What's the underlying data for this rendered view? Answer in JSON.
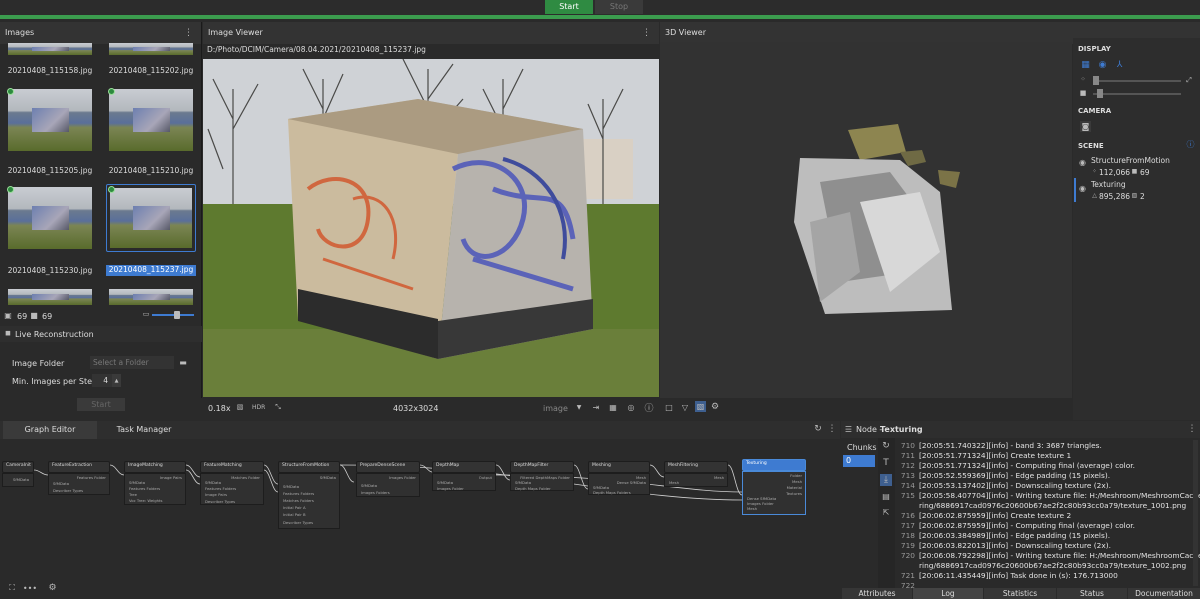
{
  "toolbar": {
    "start_label": "Start",
    "stop_label": "Stop"
  },
  "images_panel": {
    "title": "Images",
    "thumbnails": [
      {
        "label": "20210408_115158.jpg"
      },
      {
        "label": "20210408_115202.jpg"
      },
      {
        "label": "20210408_115205.jpg"
      },
      {
        "label": "20210408_115210.jpg"
      },
      {
        "label": "20210408_115230.jpg"
      },
      {
        "label": "20210408_115237.jpg"
      }
    ],
    "image_count": "69",
    "camera_count": "69",
    "live_reconstruction": {
      "title": "Live Reconstruction",
      "image_folder_label": "Image Folder",
      "image_folder_placeholder": "Select a Folder",
      "min_images_label": "Min. Images per Step",
      "min_images_value": "4",
      "start_label": "Start"
    }
  },
  "image_viewer": {
    "title": "Image Viewer",
    "path": "D:/Photo/DCIM/Camera/08.04.2021/20210408_115237.jpg",
    "zoom": "0.18x",
    "hdr_label": "HDR",
    "resolution": "4032x3024",
    "mode_value": "image"
  },
  "viewer3d": {
    "title": "3D Viewer"
  },
  "display_panel": {
    "display_label": "DISPLAY",
    "camera_label": "CAMERA",
    "scene_label": "SCENE",
    "scene_items": [
      {
        "name": "StructureFromMotion",
        "stat1": "112,066",
        "stat2": "69"
      },
      {
        "name": "Texturing",
        "stat1": "895,286",
        "stat2": "2"
      }
    ]
  },
  "graph": {
    "tabs": [
      "Graph Editor",
      "Task Manager"
    ],
    "nodes": [
      {
        "title": "CameraInit",
        "ports": [
          "SfMData"
        ]
      },
      {
        "title": "FeatureExtraction",
        "ports": [
          "Features Folder",
          "SfMData",
          "Describer Types"
        ]
      },
      {
        "title": "ImageMatching",
        "ports": [
          "Image Pairs",
          "SfMData",
          "Features Folders",
          "Tree",
          "Voc Tree: Weights"
        ]
      },
      {
        "title": "FeatureMatching",
        "ports": [
          "Matches Folder",
          "SfMData",
          "Features Folders",
          "Image Pairs",
          "Describer Types"
        ]
      },
      {
        "title": "StructureFromMotion",
        "ports": [
          "SfMData",
          "SfMData",
          "Features Folders",
          "Matches Folders",
          "Initial Pair A",
          "Initial Pair B",
          "Describer Types"
        ]
      },
      {
        "title": "PrepareDenseScene",
        "ports": [
          "Images Folder",
          "SfMData",
          "Images Folders"
        ]
      },
      {
        "title": "DepthMap",
        "ports": [
          "Output",
          "SfMData",
          "Images Folder"
        ]
      },
      {
        "title": "DepthMapFilter",
        "ports": [
          "Filtered DepthMaps Folder",
          "SfMData",
          "Depth Maps Folder"
        ]
      },
      {
        "title": "Meshing",
        "ports": [
          "Mesh",
          "Dense SfMData",
          "SfMData",
          "Depth Maps Folders"
        ]
      },
      {
        "title": "MeshFiltering",
        "ports": [
          "Mesh",
          "Mesh"
        ]
      },
      {
        "title": "Texturing",
        "ports": [
          "Folder",
          "Mesh",
          "Material",
          "Textures",
          "Dense SfMData",
          "Images Folder",
          "Mesh"
        ]
      }
    ]
  },
  "node_panel": {
    "title_prefix": "Node - ",
    "title_node": "Texturing",
    "chunks_label": "Chunks",
    "chunk_value": "0",
    "log_lines": [
      {
        "n": "710",
        "text": "[20:05:51.740322][info]       - band 3: 3687 triangles."
      },
      {
        "n": "711",
        "text": "[20:05:51.771324][info] Create texture 1"
      },
      {
        "n": "712",
        "text": "[20:05:51.771324][info]   - Computing final (average) color."
      },
      {
        "n": "713",
        "text": "[20:05:52.559369][info]   - Edge padding (15 pixels)."
      },
      {
        "n": "714",
        "text": "[20:05:53.137402][info]   - Downscaling texture (2x)."
      },
      {
        "n": "715",
        "text": "[20:05:58.407704][info]   - Writing texture file: H:/Meshroom/MeshroomCache/Textu"
      },
      {
        "n": "",
        "text": "ring/6886917cad0976c20600b67ae2f2c80b93cc0a79/texture_1001.png"
      },
      {
        "n": "716",
        "text": "[20:06:02.875959][info] Create texture 2"
      },
      {
        "n": "717",
        "text": "[20:06:02.875959][info]   - Computing final (average) color."
      },
      {
        "n": "718",
        "text": "[20:06:03.384989][info]   - Edge padding (15 pixels)."
      },
      {
        "n": "719",
        "text": "[20:06:03.822013][info]   - Downscaling texture (2x)."
      },
      {
        "n": "720",
        "text": "[20:06:08.792298][info]   - Writing texture file: H:/Meshroom/MeshroomCache/Textu"
      },
      {
        "n": "",
        "text": "ring/6886917cad0976c20600b67ae2f2c80b93cc0a79/texture_1002.png"
      },
      {
        "n": "721",
        "text": "[20:06:11.435449][info] Task done in (s): 176.713000"
      },
      {
        "n": "722",
        "text": ""
      }
    ],
    "tabs": [
      "Attributes",
      "Log",
      "Statistics",
      "Status",
      "Documentation"
    ]
  },
  "colors": {
    "accent": "#3e7bd1",
    "green": "#3b9c4e",
    "selected_node_border": "#4a8ad9"
  }
}
